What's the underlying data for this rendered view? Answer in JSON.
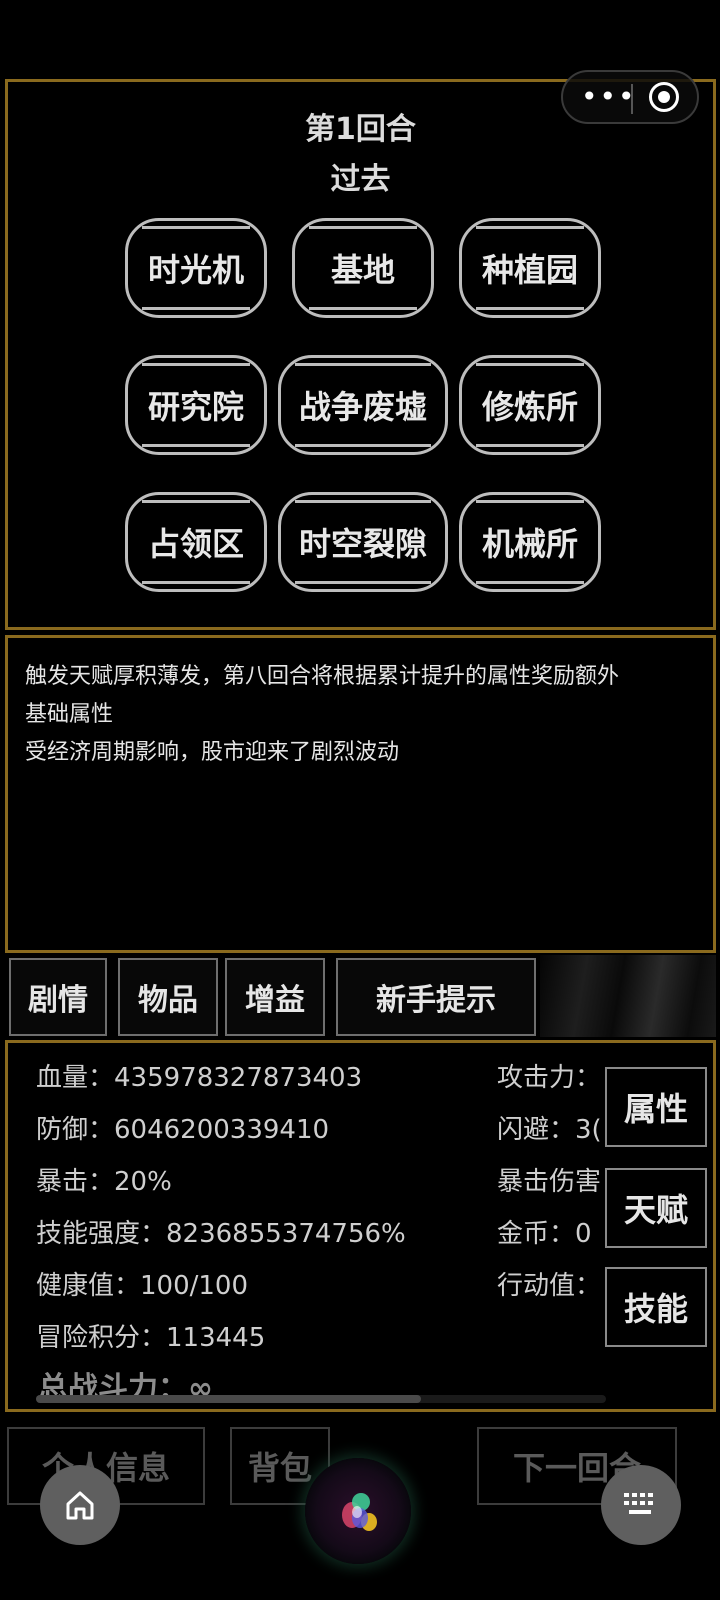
{
  "top_panel": {
    "round": "第1回合",
    "era": "过去",
    "locations": [
      "时光机",
      "基地",
      "种植园",
      "研究院",
      "战争废墟",
      "修炼所",
      "占领区",
      "时空裂隙",
      "机械所"
    ]
  },
  "event_log": [
    "触发天赋厚积薄发，第八回合将根据累计提升的属性奖励额外",
    "基础属性",
    "受经济周期影响，股市迎来了剧烈波动"
  ],
  "tabs": [
    "剧情",
    "物品",
    "增益",
    "新手提示"
  ],
  "stats": {
    "left": [
      "血量：435978327873403",
      "防御：6046200339410",
      "暴击：20%",
      "技能强度：8236855374756%",
      "健康值：100/100",
      "冒险积分：113445",
      "总战斗力：∞"
    ],
    "right": [
      "攻击力：",
      "闪避：3(",
      "暴击伤害",
      "金币：0",
      "行动值："
    ],
    "side_buttons": [
      "属性",
      "天赋",
      "技能"
    ]
  },
  "bottom_nav": {
    "personal": "个人信息",
    "bag": "背包",
    "next": "下一回合"
  },
  "icons": {
    "capsule_more": "more-dots-icon",
    "capsule_close": "target-icon",
    "home": "home-icon",
    "keyboard": "keyboard-icon"
  }
}
